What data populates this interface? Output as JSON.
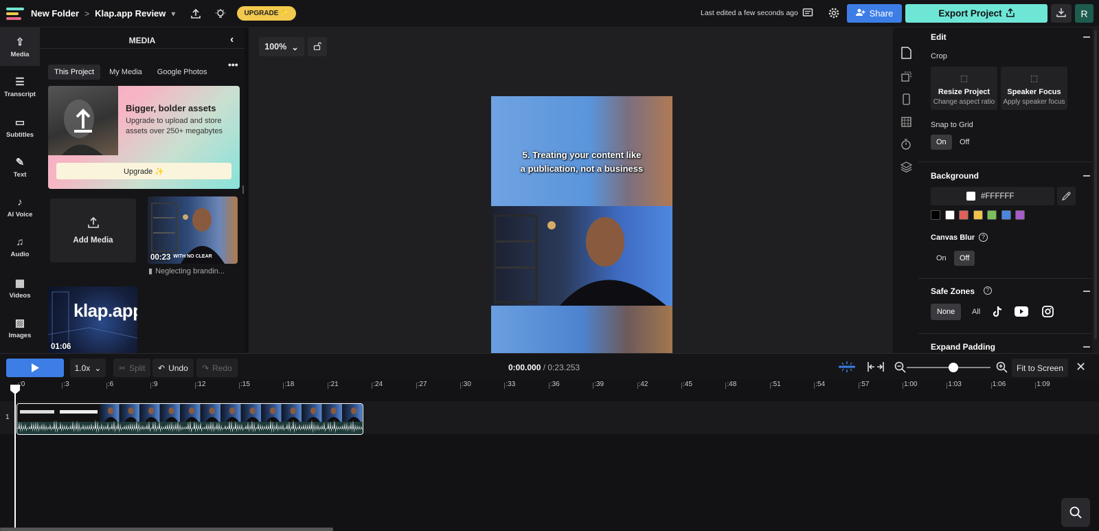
{
  "header": {
    "folder": "New Folder",
    "project": "Klap.app Review",
    "upgrade": "UPGRADE ✨",
    "last_edited": "Last edited a few seconds ago",
    "share": "Share",
    "export": "Export Project",
    "avatar": "R"
  },
  "nav": [
    {
      "label": "Media",
      "icon": "⇪"
    },
    {
      "label": "Transcript",
      "icon": "☰"
    },
    {
      "label": "Subtitles",
      "icon": "▭"
    },
    {
      "label": "Text",
      "icon": "✎"
    },
    {
      "label": "AI Voice",
      "icon": "♪"
    },
    {
      "label": "Audio",
      "icon": "♫"
    },
    {
      "label": "Videos",
      "icon": "▦"
    },
    {
      "label": "Images",
      "icon": "▨"
    }
  ],
  "media": {
    "title": "MEDIA",
    "tabs": [
      "This Project",
      "My Media",
      "Google Photos"
    ],
    "promo_title": "Bigger, bolder assets",
    "promo_text": "Upgrade to upload and store assets over 250+ megabytes",
    "promo_button": "Upgrade ✨",
    "add_media": "Add Media",
    "thumb1_duration": "00:23",
    "thumb1_caption": "WITH NO CLEAR",
    "thumb1_name": "Neglecting brandin...",
    "thumb2_duration": "01:06",
    "thumb2_text": "klap.app"
  },
  "stage": {
    "zoom": "100%",
    "caption_line1": "5. Treating your content like",
    "caption_line2": "a publication, not a business"
  },
  "props": {
    "edit": "Edit",
    "crop": "Crop",
    "resize_title": "Resize Project",
    "resize_sub": "Change aspect ratio",
    "speaker_title": "Speaker Focus",
    "speaker_sub": "Apply speaker focus",
    "snap": "Snap to Grid",
    "on": "On",
    "off": "Off",
    "background": "Background",
    "bg_hex": "#FFFFFF",
    "swatches": [
      "#000000",
      "#ffffff",
      "#e0605a",
      "#f2c24a",
      "#79c05a",
      "#4a86e0",
      "#a45cc8"
    ],
    "canvas_blur": "Canvas Blur",
    "safe_zones": "Safe Zones",
    "none": "None",
    "all": "All",
    "expand_padding": "Expand Padding"
  },
  "timeline": {
    "speed": "1.0x",
    "split": "Split",
    "undo": "Undo",
    "redo": "Redo",
    "time_current": "0:00.000",
    "time_total": "/ 0:23.253",
    "fit": "Fit to Screen",
    "track_number": "1",
    "ticks": [
      ":0",
      ":3",
      ":6",
      ":9",
      ":12",
      ":15",
      ":18",
      ":21",
      ":24",
      ":27",
      ":30",
      ":33",
      ":36",
      ":39",
      ":42",
      ":45",
      ":48",
      ":51",
      ":54",
      ":57",
      "1:00",
      "1:03",
      "1:06",
      "1:09"
    ]
  }
}
